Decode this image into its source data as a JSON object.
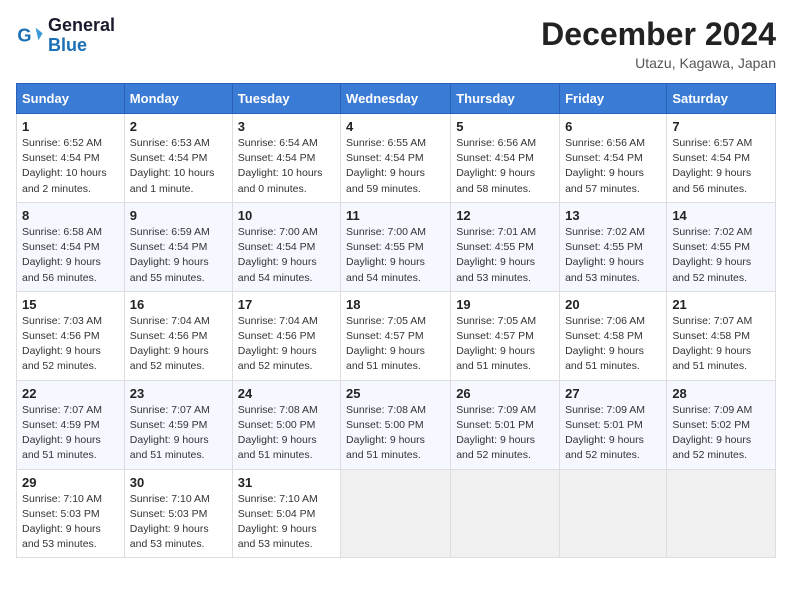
{
  "header": {
    "logo": {
      "line1": "General",
      "line2": "Blue"
    },
    "title": "December 2024",
    "location": "Utazu, Kagawa, Japan"
  },
  "columns": [
    "Sunday",
    "Monday",
    "Tuesday",
    "Wednesday",
    "Thursday",
    "Friday",
    "Saturday"
  ],
  "weeks": [
    [
      {
        "day": "1",
        "sunrise": "Sunrise: 6:52 AM",
        "sunset": "Sunset: 4:54 PM",
        "daylight": "Daylight: 10 hours and 2 minutes."
      },
      {
        "day": "2",
        "sunrise": "Sunrise: 6:53 AM",
        "sunset": "Sunset: 4:54 PM",
        "daylight": "Daylight: 10 hours and 1 minute."
      },
      {
        "day": "3",
        "sunrise": "Sunrise: 6:54 AM",
        "sunset": "Sunset: 4:54 PM",
        "daylight": "Daylight: 10 hours and 0 minutes."
      },
      {
        "day": "4",
        "sunrise": "Sunrise: 6:55 AM",
        "sunset": "Sunset: 4:54 PM",
        "daylight": "Daylight: 9 hours and 59 minutes."
      },
      {
        "day": "5",
        "sunrise": "Sunrise: 6:56 AM",
        "sunset": "Sunset: 4:54 PM",
        "daylight": "Daylight: 9 hours and 58 minutes."
      },
      {
        "day": "6",
        "sunrise": "Sunrise: 6:56 AM",
        "sunset": "Sunset: 4:54 PM",
        "daylight": "Daylight: 9 hours and 57 minutes."
      },
      {
        "day": "7",
        "sunrise": "Sunrise: 6:57 AM",
        "sunset": "Sunset: 4:54 PM",
        "daylight": "Daylight: 9 hours and 56 minutes."
      }
    ],
    [
      {
        "day": "8",
        "sunrise": "Sunrise: 6:58 AM",
        "sunset": "Sunset: 4:54 PM",
        "daylight": "Daylight: 9 hours and 56 minutes."
      },
      {
        "day": "9",
        "sunrise": "Sunrise: 6:59 AM",
        "sunset": "Sunset: 4:54 PM",
        "daylight": "Daylight: 9 hours and 55 minutes."
      },
      {
        "day": "10",
        "sunrise": "Sunrise: 7:00 AM",
        "sunset": "Sunset: 4:54 PM",
        "daylight": "Daylight: 9 hours and 54 minutes."
      },
      {
        "day": "11",
        "sunrise": "Sunrise: 7:00 AM",
        "sunset": "Sunset: 4:55 PM",
        "daylight": "Daylight: 9 hours and 54 minutes."
      },
      {
        "day": "12",
        "sunrise": "Sunrise: 7:01 AM",
        "sunset": "Sunset: 4:55 PM",
        "daylight": "Daylight: 9 hours and 53 minutes."
      },
      {
        "day": "13",
        "sunrise": "Sunrise: 7:02 AM",
        "sunset": "Sunset: 4:55 PM",
        "daylight": "Daylight: 9 hours and 53 minutes."
      },
      {
        "day": "14",
        "sunrise": "Sunrise: 7:02 AM",
        "sunset": "Sunset: 4:55 PM",
        "daylight": "Daylight: 9 hours and 52 minutes."
      }
    ],
    [
      {
        "day": "15",
        "sunrise": "Sunrise: 7:03 AM",
        "sunset": "Sunset: 4:56 PM",
        "daylight": "Daylight: 9 hours and 52 minutes."
      },
      {
        "day": "16",
        "sunrise": "Sunrise: 7:04 AM",
        "sunset": "Sunset: 4:56 PM",
        "daylight": "Daylight: 9 hours and 52 minutes."
      },
      {
        "day": "17",
        "sunrise": "Sunrise: 7:04 AM",
        "sunset": "Sunset: 4:56 PM",
        "daylight": "Daylight: 9 hours and 52 minutes."
      },
      {
        "day": "18",
        "sunrise": "Sunrise: 7:05 AM",
        "sunset": "Sunset: 4:57 PM",
        "daylight": "Daylight: 9 hours and 51 minutes."
      },
      {
        "day": "19",
        "sunrise": "Sunrise: 7:05 AM",
        "sunset": "Sunset: 4:57 PM",
        "daylight": "Daylight: 9 hours and 51 minutes."
      },
      {
        "day": "20",
        "sunrise": "Sunrise: 7:06 AM",
        "sunset": "Sunset: 4:58 PM",
        "daylight": "Daylight: 9 hours and 51 minutes."
      },
      {
        "day": "21",
        "sunrise": "Sunrise: 7:07 AM",
        "sunset": "Sunset: 4:58 PM",
        "daylight": "Daylight: 9 hours and 51 minutes."
      }
    ],
    [
      {
        "day": "22",
        "sunrise": "Sunrise: 7:07 AM",
        "sunset": "Sunset: 4:59 PM",
        "daylight": "Daylight: 9 hours and 51 minutes."
      },
      {
        "day": "23",
        "sunrise": "Sunrise: 7:07 AM",
        "sunset": "Sunset: 4:59 PM",
        "daylight": "Daylight: 9 hours and 51 minutes."
      },
      {
        "day": "24",
        "sunrise": "Sunrise: 7:08 AM",
        "sunset": "Sunset: 5:00 PM",
        "daylight": "Daylight: 9 hours and 51 minutes."
      },
      {
        "day": "25",
        "sunrise": "Sunrise: 7:08 AM",
        "sunset": "Sunset: 5:00 PM",
        "daylight": "Daylight: 9 hours and 51 minutes."
      },
      {
        "day": "26",
        "sunrise": "Sunrise: 7:09 AM",
        "sunset": "Sunset: 5:01 PM",
        "daylight": "Daylight: 9 hours and 52 minutes."
      },
      {
        "day": "27",
        "sunrise": "Sunrise: 7:09 AM",
        "sunset": "Sunset: 5:01 PM",
        "daylight": "Daylight: 9 hours and 52 minutes."
      },
      {
        "day": "28",
        "sunrise": "Sunrise: 7:09 AM",
        "sunset": "Sunset: 5:02 PM",
        "daylight": "Daylight: 9 hours and 52 minutes."
      }
    ],
    [
      {
        "day": "29",
        "sunrise": "Sunrise: 7:10 AM",
        "sunset": "Sunset: 5:03 PM",
        "daylight": "Daylight: 9 hours and 53 minutes."
      },
      {
        "day": "30",
        "sunrise": "Sunrise: 7:10 AM",
        "sunset": "Sunset: 5:03 PM",
        "daylight": "Daylight: 9 hours and 53 minutes."
      },
      {
        "day": "31",
        "sunrise": "Sunrise: 7:10 AM",
        "sunset": "Sunset: 5:04 PM",
        "daylight": "Daylight: 9 hours and 53 minutes."
      },
      null,
      null,
      null,
      null
    ]
  ]
}
